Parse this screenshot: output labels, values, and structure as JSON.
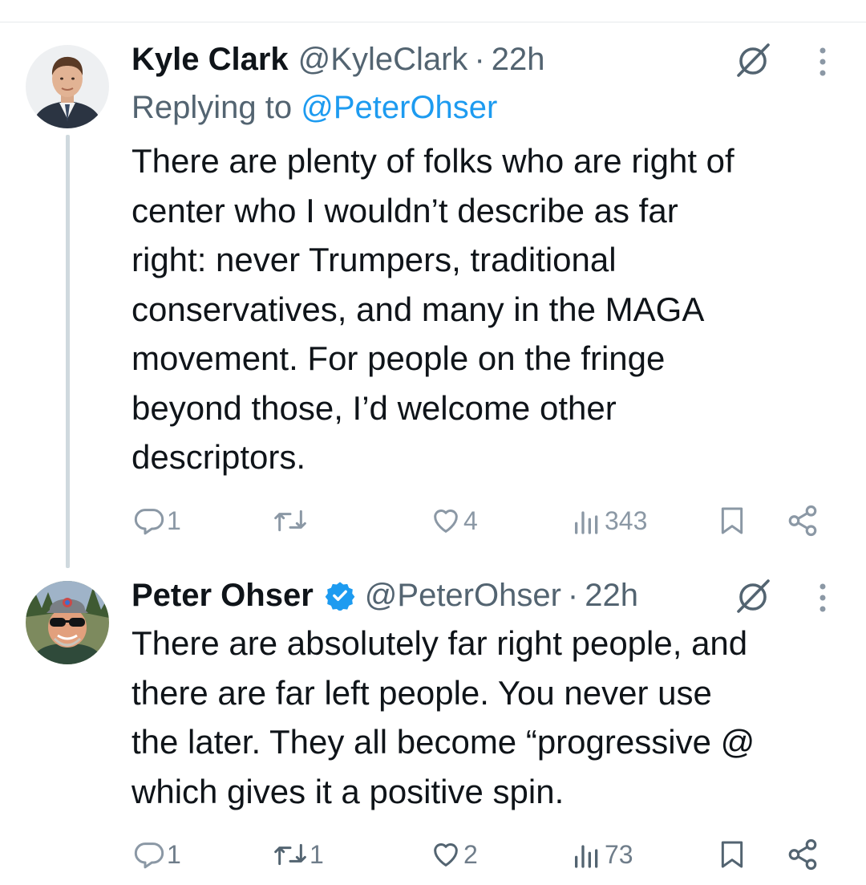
{
  "tweets": [
    {
      "display_name": "Kyle Clark",
      "handle": "@KyleClark",
      "separator": "·",
      "time": "22h",
      "verified": false,
      "replying_prefix": "Replying to ",
      "replying_to": "@PeterOhser",
      "text": "There are plenty of folks who are right of\ncenter who I wouldn’t describe as far\nright: never Trumpers, traditional\nconservatives, and many in the MAGA\nmovement. For people on the fringe\nbeyond those, I’d welcome other\ndescriptors.",
      "actions": {
        "replies": "1",
        "reposts": "",
        "likes": "4",
        "views": "343"
      }
    },
    {
      "display_name": "Peter Ohser",
      "handle": "@PeterOhser",
      "separator": "·",
      "time": "22h",
      "verified": true,
      "text": "There are absolutely far right people, and\nthere are far left people.  You never use\nthe later.  They all become “progressive @\nwhich gives it a positive spin.",
      "actions": {
        "replies": "1",
        "reposts": "1",
        "likes": "2",
        "views": "73"
      }
    }
  ],
  "colors": {
    "text": "#0f1419",
    "secondary": "#536471",
    "link": "#1d9bf0",
    "icon": "#8b98a5",
    "thread_line": "#cfd9de",
    "verified": "#1d9bf0"
  },
  "icons": {
    "reply": "reply-icon",
    "repost": "repost-icon",
    "like": "heart-icon",
    "views": "views-icon",
    "bookmark": "bookmark-icon",
    "share": "share-icon",
    "grok": "grok-icon",
    "more": "more-options-icon",
    "verified": "verified-badge-icon"
  }
}
